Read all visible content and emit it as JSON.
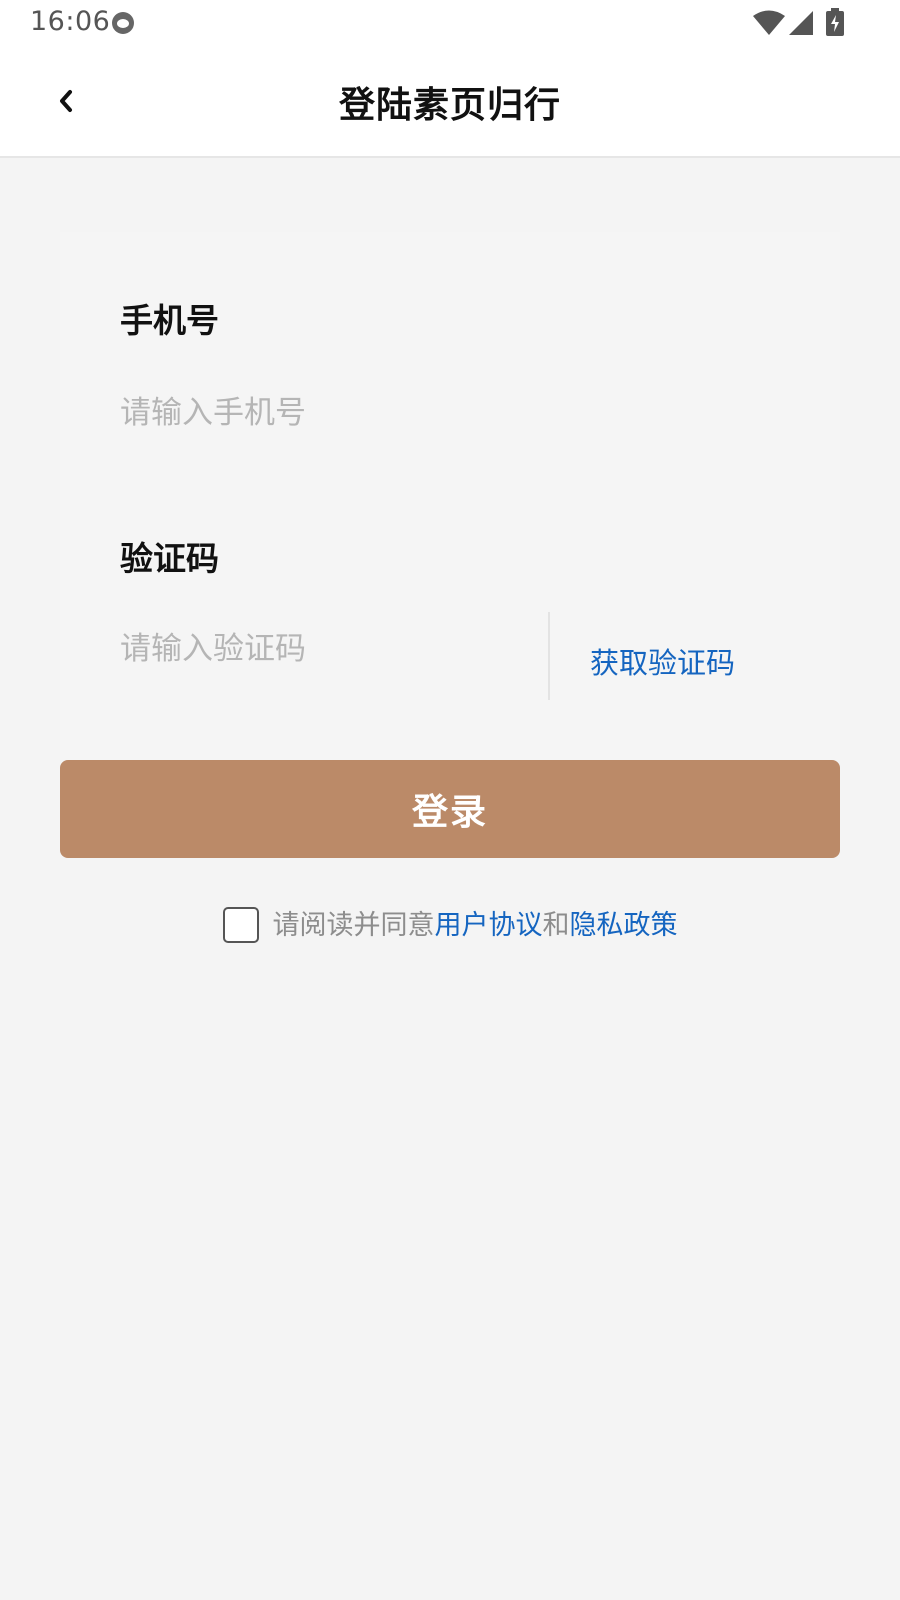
{
  "status_bar": {
    "time": "16:06"
  },
  "header": {
    "back_icon": "chevron-left-icon",
    "title": "登陆素页归行"
  },
  "form": {
    "phone_label": "手机号",
    "phone_placeholder": "请输入手机号",
    "phone_value": "",
    "code_label": "验证码",
    "code_placeholder": "请输入验证码",
    "code_value": "",
    "get_code_label": "获取验证码"
  },
  "login_button": {
    "label": "登录",
    "color": "#bb8a68"
  },
  "agreement": {
    "checked": false,
    "prefix": "请阅读并同意",
    "user_agreement": "用户协议",
    "conjunction": "和",
    "privacy_policy": "隐私政策",
    "link_color": "#1565c0"
  }
}
